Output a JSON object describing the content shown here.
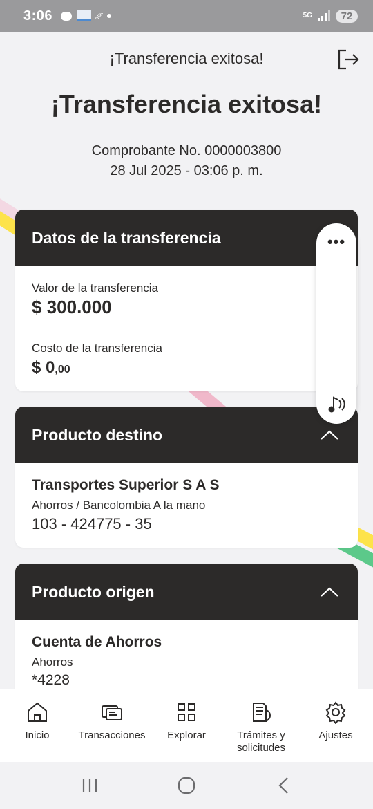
{
  "status": {
    "time": "3:06",
    "network": "5G",
    "battery": "72"
  },
  "header": {
    "title": "¡Transferencia exitosa!"
  },
  "main": {
    "title": "¡Transferencia exitosa!",
    "receipt": "Comprobante No. 0000003800",
    "datetime": "28 Jul 2025 - 03:06 p. m."
  },
  "transfer": {
    "heading": "Datos de la transferencia",
    "value_label": "Valor de la transferencia",
    "value": "$ 300.000",
    "cost_label": "Costo de la transferencia",
    "cost_main": "$ 0",
    "cost_cents": ",00"
  },
  "destination": {
    "heading": "Producto destino",
    "name": "Transportes Superior S A S",
    "type": "Ahorros / Bancolombia A la mano",
    "account": "103 - 424775 - 35"
  },
  "origin": {
    "heading": "Producto origen",
    "name": "Cuenta de Ahorros",
    "type": "Ahorros",
    "account": "*4228"
  },
  "nav": {
    "items": [
      {
        "label": "Inicio",
        "icon": "home-icon"
      },
      {
        "label": "Transacciones",
        "icon": "transactions-icon"
      },
      {
        "label": "Explorar",
        "icon": "grid-icon"
      },
      {
        "label": "Trámites y solicitudes",
        "icon": "documents-icon"
      },
      {
        "label": "Ajustes",
        "icon": "gear-icon"
      }
    ]
  },
  "colors": {
    "dark": "#2c2a29",
    "background": "#f2f2f4"
  }
}
